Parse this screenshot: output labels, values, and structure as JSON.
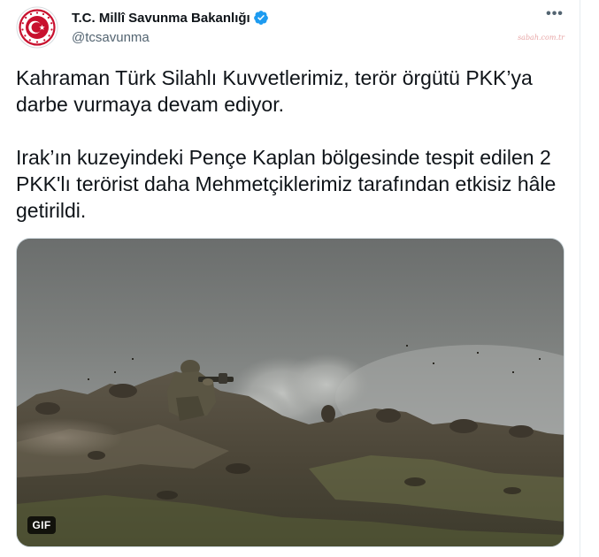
{
  "account": {
    "display_name": "T.C. Millî Savunma Bakanlığı",
    "handle": "@tcsavunma",
    "verified": true,
    "avatar_icon": "turkish-crescent-star-emblem-icon",
    "brand_color": "#c8102e",
    "verified_color": "#1d9bf0"
  },
  "header": {
    "more_icon": "more-horizontal-icon",
    "more_label": "•••",
    "watermark_text": "sabah.com.tr"
  },
  "tweet": {
    "paragraphs": [
      "Kahraman Türk Silahlı Kuvvetlerimiz, terör örgütü PKK’ya darbe vurmaya devam ediyor.",
      "Irak’ın kuzeyindeki Pençe Kaplan bölgesinde tespit edilen 2 PKK'lı terörist daha Mehmetçiklerimiz tarafından etkisiz hâle getirildi."
    ]
  },
  "media": {
    "type": "gif",
    "badge_label": "GIF",
    "scene_icon": "gif-video-still-soldiers-on-ridge"
  },
  "colors": {
    "text_primary": "#0f1419",
    "text_secondary": "#536471",
    "border": "#cfd9de"
  }
}
